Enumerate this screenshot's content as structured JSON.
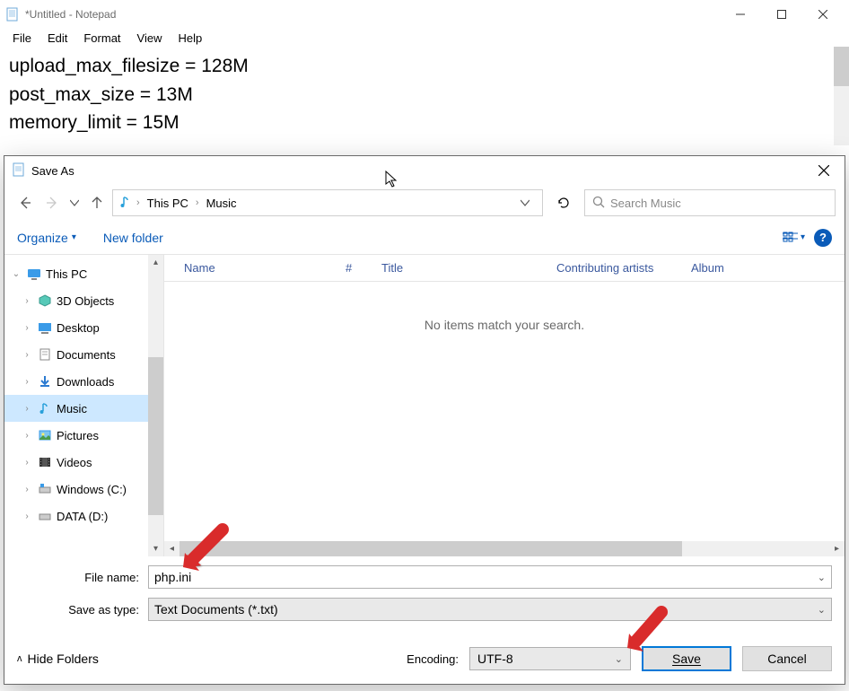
{
  "notepad": {
    "title": "*Untitled - Notepad",
    "menu": {
      "file": "File",
      "edit": "Edit",
      "format": "Format",
      "view": "View",
      "help": "Help"
    },
    "lines": [
      "upload_max_filesize = 128M",
      "post_max_size = 13M",
      "memory_limit = 15M"
    ]
  },
  "dialog": {
    "title": "Save As",
    "breadcrumb": {
      "root": "This PC",
      "folder": "Music"
    },
    "search": {
      "placeholder": "Search Music"
    },
    "toolbar": {
      "organize": "Organize",
      "newfolder": "New folder"
    },
    "tree": {
      "root": "This PC",
      "items": [
        {
          "label": "3D Objects"
        },
        {
          "label": "Desktop"
        },
        {
          "label": "Documents"
        },
        {
          "label": "Downloads"
        },
        {
          "label": "Music",
          "selected": true
        },
        {
          "label": "Pictures"
        },
        {
          "label": "Videos"
        },
        {
          "label": "Windows (C:)"
        },
        {
          "label": "DATA (D:)"
        }
      ]
    },
    "columns": {
      "name": "Name",
      "num": "#",
      "title": "Title",
      "contrib": "Contributing artists",
      "album": "Album"
    },
    "empty": "No items match your search.",
    "filename": {
      "label": "File name:",
      "value": "php.ini"
    },
    "savetype": {
      "label": "Save as type:",
      "value": "Text Documents (*.txt)"
    },
    "encoding": {
      "label": "Encoding:",
      "value": "UTF-8"
    },
    "buttons": {
      "save": "Save",
      "cancel": "Cancel"
    },
    "hidefolders": "Hide Folders"
  }
}
